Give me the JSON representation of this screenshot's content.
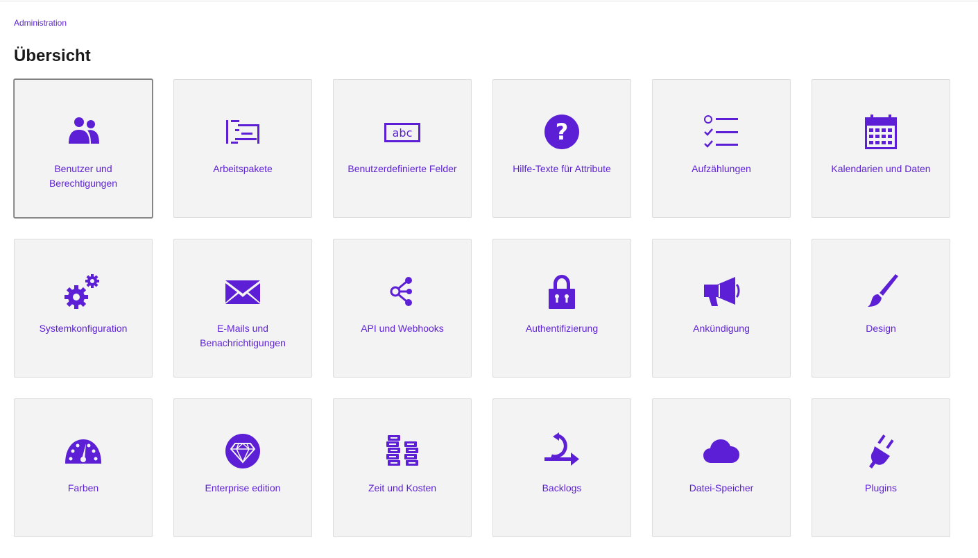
{
  "breadcrumb": "Administration",
  "page_title": "Übersicht",
  "accent_color": "#5c1fd6",
  "tiles": [
    {
      "label": "Benutzer und Berechtigungen",
      "icon": "users-icon"
    },
    {
      "label": "Arbeitspakete",
      "icon": "work-packages-icon"
    },
    {
      "label": "Benutzerdefinierte Felder",
      "icon": "custom-fields-icon"
    },
    {
      "label": "Hilfe-Texte für Attribute",
      "icon": "help-icon"
    },
    {
      "label": "Aufzählungen",
      "icon": "enumerations-icon"
    },
    {
      "label": "Kalendarien und Daten",
      "icon": "calendar-icon"
    },
    {
      "label": "Systemkonfiguration",
      "icon": "gears-icon"
    },
    {
      "label": "E-Mails und Benachrichtigungen",
      "icon": "mail-icon"
    },
    {
      "label": "API und Webhooks",
      "icon": "webhooks-icon"
    },
    {
      "label": "Authentifizierung",
      "icon": "lock-icon"
    },
    {
      "label": "Ankündigung",
      "icon": "megaphone-icon"
    },
    {
      "label": "Design",
      "icon": "paintbrush-icon"
    },
    {
      "label": "Farben",
      "icon": "gauge-icon"
    },
    {
      "label": "Enterprise edition",
      "icon": "diamond-icon"
    },
    {
      "label": "Zeit und Kosten",
      "icon": "time-costs-icon"
    },
    {
      "label": "Backlogs",
      "icon": "backlogs-icon"
    },
    {
      "label": "Datei-Speicher",
      "icon": "cloud-icon"
    },
    {
      "label": "Plugins",
      "icon": "plug-icon"
    }
  ]
}
